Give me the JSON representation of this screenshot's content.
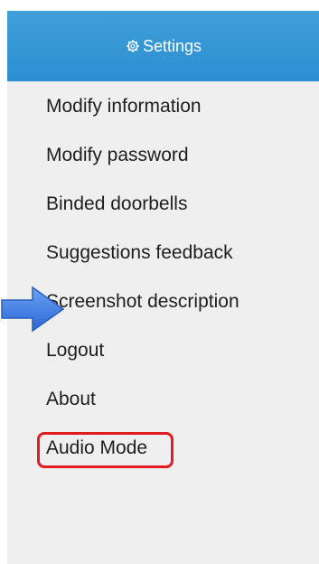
{
  "header": {
    "title": "Settings",
    "icon": "gear-icon",
    "bg_color": "#3399dd"
  },
  "menu": {
    "items": [
      {
        "label": "Modify information"
      },
      {
        "label": "Modify password"
      },
      {
        "label": "Binded doorbells"
      },
      {
        "label": "Suggestions feedback"
      },
      {
        "label": "Screenshot description"
      },
      {
        "label": "Logout"
      },
      {
        "label": "About"
      },
      {
        "label": "Audio Mode"
      }
    ]
  },
  "annotations": {
    "arrow_color": "#3b7be0",
    "highlight_color": "#e31b22"
  }
}
